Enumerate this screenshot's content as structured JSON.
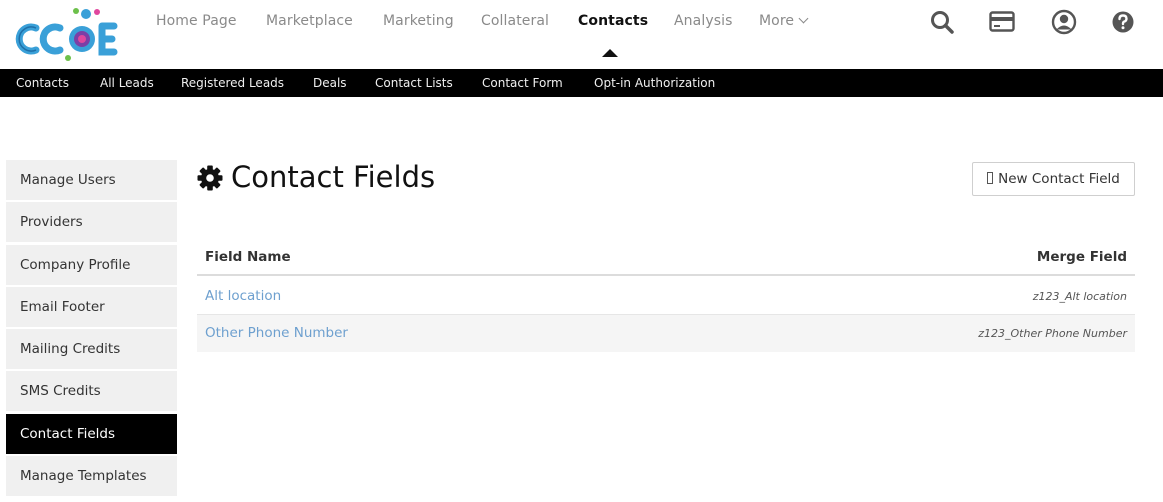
{
  "brand": {
    "logo_text": "CCOE",
    "colors": {
      "logo_blue": "#3aa0d8",
      "logo_purple": "#7b3fa6",
      "logo_green": "#6cc04a",
      "logo_pink": "#e0479e",
      "link": "#6ea0cf"
    }
  },
  "nav": {
    "items": [
      {
        "label": "Home Page",
        "active": false
      },
      {
        "label": "Marketplace",
        "active": false
      },
      {
        "label": "Marketing",
        "active": false
      },
      {
        "label": "Collateral",
        "active": false
      },
      {
        "label": "Contacts",
        "active": true
      },
      {
        "label": "Analysis",
        "active": false
      },
      {
        "label": "More",
        "active": false
      }
    ],
    "icons": [
      "search-icon",
      "credit-card-icon",
      "user-account-icon",
      "help-icon"
    ]
  },
  "subnav": {
    "items": [
      "Contacts",
      "All Leads",
      "Registered Leads",
      "Deals",
      "Contact Lists",
      "Contact Form",
      "Opt-in Authorization"
    ]
  },
  "sidebar": {
    "items": [
      {
        "label": "Manage Users",
        "active": false
      },
      {
        "label": "Providers",
        "active": false
      },
      {
        "label": "Company Profile",
        "active": false
      },
      {
        "label": "Email Footer",
        "active": false
      },
      {
        "label": "Mailing Credits",
        "active": false
      },
      {
        "label": "SMS Credits",
        "active": false
      },
      {
        "label": "Contact Fields",
        "active": true
      },
      {
        "label": "Manage Templates",
        "active": false
      }
    ]
  },
  "main": {
    "title": "Contact Fields",
    "title_icon": "gear-icon",
    "new_button_label": "New Contact Field",
    "table": {
      "columns": [
        "Field Name",
        "Merge Field"
      ],
      "rows": [
        {
          "field_name": "Alt location",
          "merge_field": "z123_Alt location"
        },
        {
          "field_name": "Other Phone Number",
          "merge_field": "z123_Other Phone Number"
        }
      ]
    }
  }
}
